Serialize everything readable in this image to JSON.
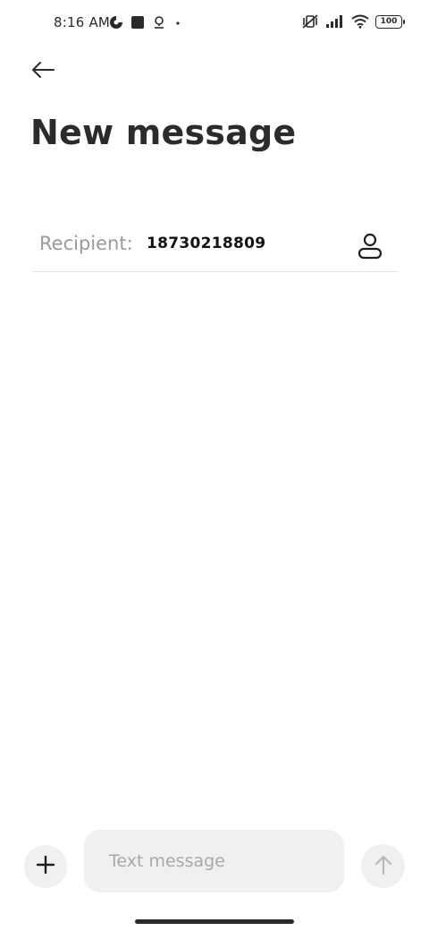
{
  "status_bar": {
    "time": "8:16 AM",
    "left_icons": [
      "data-saver-icon",
      "square-notification-icon",
      "location-icon",
      "dot-icon"
    ],
    "right_icons": [
      "vibrate-off-icon",
      "signal-icon",
      "wifi-icon",
      "battery-icon"
    ],
    "battery_level": "100"
  },
  "header": {
    "back_icon": "arrow-left-icon",
    "title": "New message"
  },
  "recipient": {
    "label": "Recipient:",
    "value": "18730218809",
    "contact_icon": "person-icon"
  },
  "composer": {
    "add_icon": "plus-icon",
    "placeholder": "Text message",
    "value": "",
    "send_icon": "arrow-up-icon"
  },
  "colors": {
    "background": "#ffffff",
    "surface": "#f0f0f0",
    "text_primary": "#2b2b2b",
    "text_muted": "#9a9a9a",
    "divider": "#e4e4e4"
  }
}
